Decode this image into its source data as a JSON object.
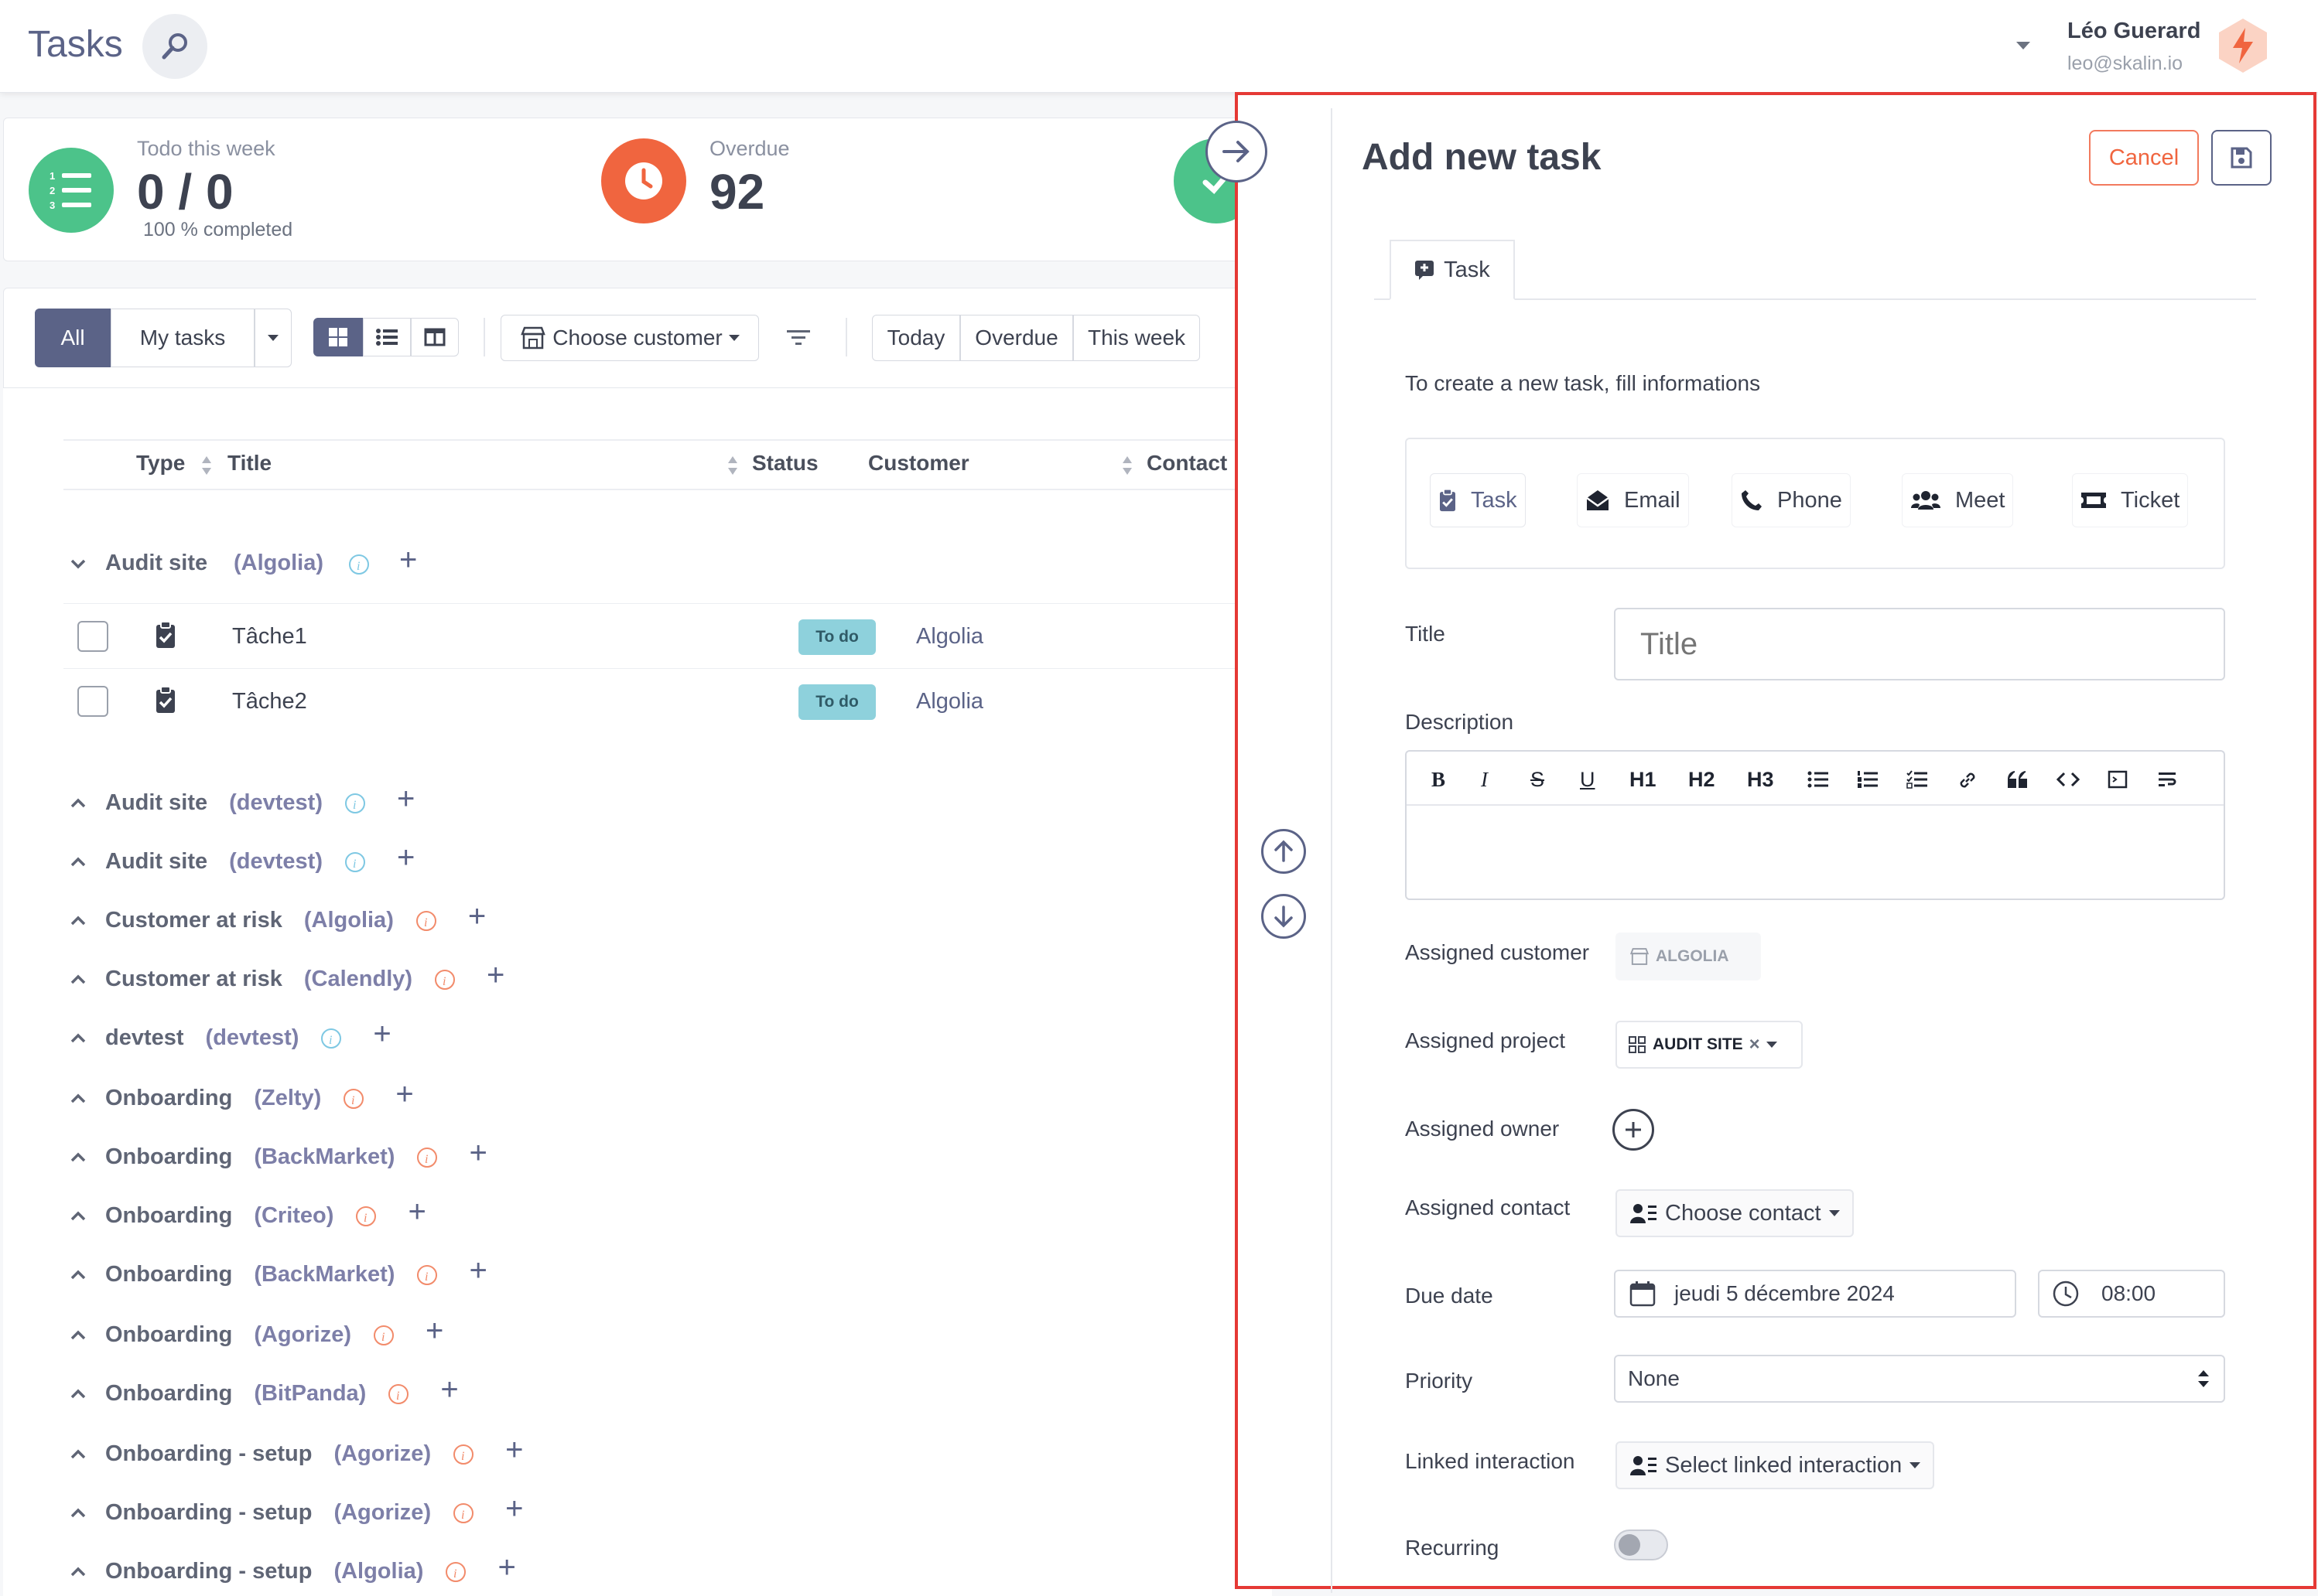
{
  "header": {
    "title": "Tasks",
    "user_name": "Léo Guerard",
    "user_email": "leo@skalin.io"
  },
  "stats": {
    "todo": {
      "label": "Todo this week",
      "value": "0 / 0",
      "sub": "100 % completed"
    },
    "overdue": {
      "label": "Overdue",
      "value": "92"
    }
  },
  "toolbar": {
    "all": "All",
    "my_tasks": "My tasks",
    "choose_customer": "Choose customer",
    "today": "Today",
    "overdue": "Overdue",
    "this_week": "This week"
  },
  "table": {
    "col_type": "Type",
    "col_title": "Title",
    "col_status": "Status",
    "col_customer": "Customer",
    "col_contact": "Contact"
  },
  "groups": [
    {
      "name": "Audit site",
      "customer": "(Algolia)",
      "expanded": true,
      "info_color": "#7ec8e3",
      "tasks": [
        {
          "title": "Tâche1",
          "status": "To do",
          "customer": "Algolia"
        },
        {
          "title": "Tâche2",
          "status": "To do",
          "customer": "Algolia"
        }
      ]
    },
    {
      "name": "Audit site",
      "customer": "(devtest)",
      "info_color": "#7ec8e3"
    },
    {
      "name": "Audit site",
      "customer": "(devtest)",
      "info_color": "#7ec8e3"
    },
    {
      "name": "Customer at risk",
      "customer": "(Algolia)",
      "info_color": "#f28b6b"
    },
    {
      "name": "Customer at risk",
      "customer": "(Calendly)",
      "info_color": "#f28b6b"
    },
    {
      "name": "devtest",
      "customer": "(devtest)",
      "info_color": "#7ec8e3"
    },
    {
      "name": "Onboarding",
      "customer": "(Zelty)",
      "info_color": "#f28b6b"
    },
    {
      "name": "Onboarding",
      "customer": "(BackMarket)",
      "info_color": "#f28b6b"
    },
    {
      "name": "Onboarding",
      "customer": "(Criteo)",
      "info_color": "#f28b6b"
    },
    {
      "name": "Onboarding",
      "customer": "(BackMarket)",
      "info_color": "#f28b6b"
    },
    {
      "name": "Onboarding",
      "customer": "(Agorize)",
      "info_color": "#f28b6b"
    },
    {
      "name": "Onboarding",
      "customer": "(BitPanda)",
      "info_color": "#f28b6b"
    },
    {
      "name": "Onboarding - setup",
      "customer": "(Agorize)",
      "info_color": "#f28b6b"
    },
    {
      "name": "Onboarding - setup",
      "customer": "(Agorize)",
      "info_color": "#f28b6b"
    },
    {
      "name": "Onboarding - setup",
      "customer": "(Algolia)",
      "info_color": "#f28b6b"
    }
  ],
  "panel": {
    "title": "Add new task",
    "cancel": "Cancel",
    "tab": "Task",
    "intro": "To create a new task, fill informations",
    "types": [
      "Task",
      "Email",
      "Phone",
      "Meet",
      "Ticket"
    ],
    "title_label": "Title",
    "title_placeholder": "Title",
    "description_label": "Description",
    "editor_tools": [
      "B",
      "I",
      "S",
      "U",
      "H1",
      "H2",
      "H3"
    ],
    "assigned_customer_label": "Assigned customer",
    "assigned_customer": "ALGOLIA",
    "assigned_project_label": "Assigned project",
    "assigned_project": "AUDIT SITE",
    "assigned_owner_label": "Assigned owner",
    "assigned_contact_label": "Assigned contact",
    "choose_contact": "Choose contact",
    "due_date_label": "Due date",
    "due_date": "jeudi 5 décembre 2024",
    "due_time": "08:00",
    "priority_label": "Priority",
    "priority": "None",
    "linked_label": "Linked interaction",
    "linked_placeholder": "Select linked interaction",
    "recurring_label": "Recurring",
    "recurring": false
  },
  "colors": {
    "primary": "#5b6387",
    "accent": "#e53935",
    "todo_green": "#4cc38a",
    "overdue_orange": "#f0653f",
    "badge": "#8ed1dc"
  }
}
